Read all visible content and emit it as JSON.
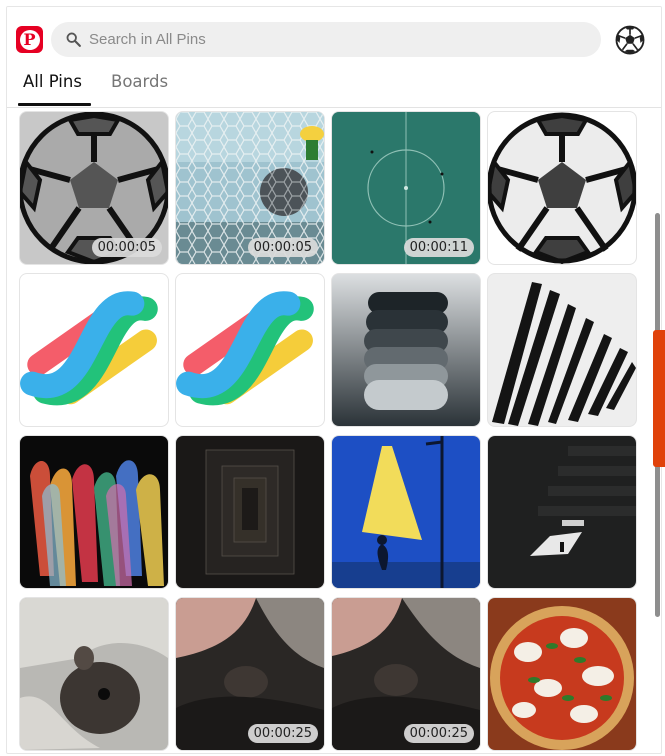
{
  "header": {
    "logo_letter": "P",
    "search_placeholder": "Search in All Pins",
    "tabs": [
      {
        "label": "All Pins",
        "active": true
      },
      {
        "label": "Boards",
        "active": false
      }
    ]
  },
  "colors": {
    "brand": "#e60023",
    "edge_tab": "#e0420a"
  },
  "pins": [
    {
      "subject": "soccer ball gray",
      "duration": "00:00:05"
    },
    {
      "subject": "ball in goal net",
      "duration": "00:00:05"
    },
    {
      "subject": "green football field aerial",
      "duration": "00:00:11"
    },
    {
      "subject": "soccer ball white",
      "duration": ""
    },
    {
      "subject": "colorful ribbon logo",
      "duration": ""
    },
    {
      "subject": "colorful ribbon logo",
      "duration": ""
    },
    {
      "subject": "grey color palette",
      "duration": ""
    },
    {
      "subject": "ink piano keys",
      "duration": ""
    },
    {
      "subject": "rainbow figures walking",
      "duration": ""
    },
    {
      "subject": "dark corridor",
      "duration": ""
    },
    {
      "subject": "street lamp light",
      "duration": ""
    },
    {
      "subject": "dark staircase",
      "duration": ""
    },
    {
      "subject": "sleeping rodent",
      "duration": ""
    },
    {
      "subject": "rodent under blanket",
      "duration": "00:00:25"
    },
    {
      "subject": "rodent under blanket",
      "duration": "00:00:25"
    },
    {
      "subject": "margherita pizza",
      "duration": ""
    }
  ]
}
